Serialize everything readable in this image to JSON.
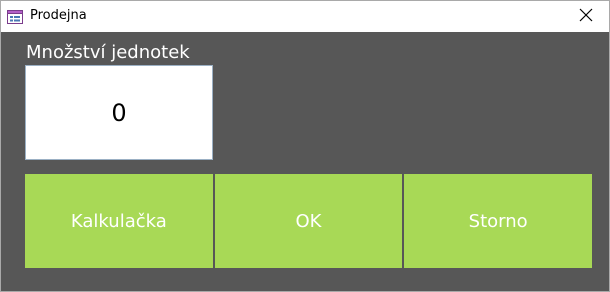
{
  "window": {
    "title": "Prodejna",
    "app_icon": "form-icon",
    "close_icon": "close-icon"
  },
  "form": {
    "quantity_label": "Množství jednotek",
    "quantity_value": "0"
  },
  "buttons": {
    "calculator_label": "Kalkulačka",
    "ok_label": "OK",
    "cancel_label": "Storno"
  },
  "colors": {
    "background": "#575757",
    "button_green": "#a8d956",
    "button_text": "#ffffff"
  }
}
